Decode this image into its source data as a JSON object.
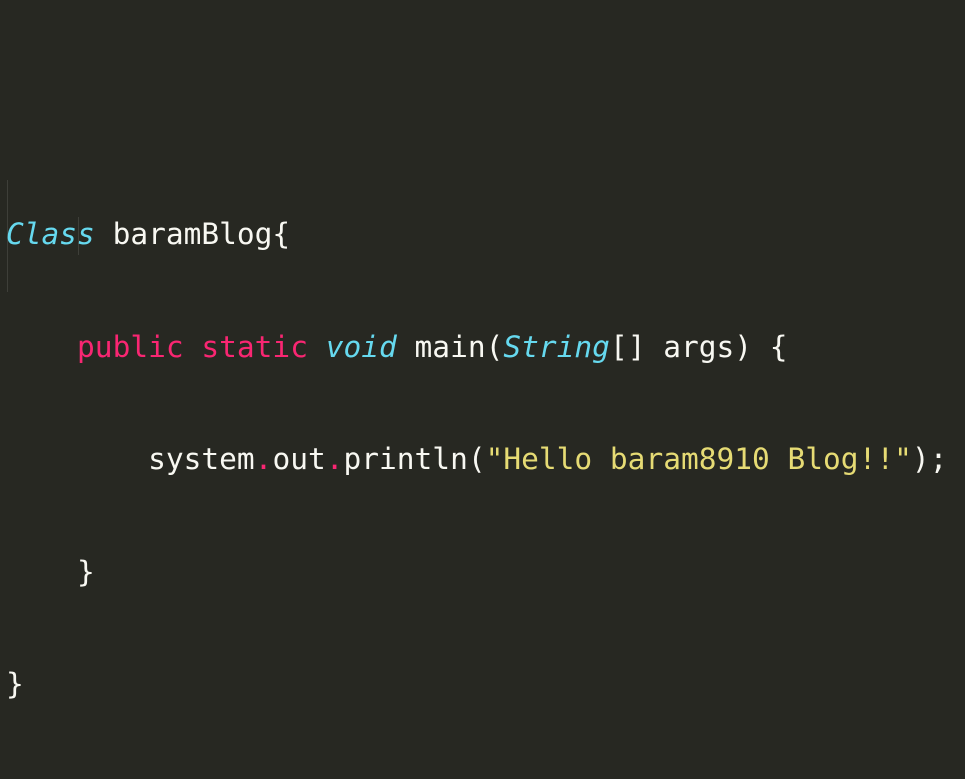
{
  "theme": {
    "background": "#272822",
    "foreground": "#F8F8F2",
    "keyword": "#F92672",
    "type": "#66D9EF",
    "string": "#E6DB74"
  },
  "code": {
    "line1": {
      "class_kw": "Class",
      "name": " baramBlog{"
    },
    "line2": {
      "indent": "    ",
      "public_kw": "public",
      "sp1": " ",
      "static_kw": "static",
      "sp2": " ",
      "void_kw": "void",
      "method": " main(",
      "string_type": "String",
      "rest": "[] args) {"
    },
    "line3": {
      "indent": "        ",
      "system": "system",
      "dot1": ".",
      "out": "out",
      "dot2": ".",
      "println": "println(",
      "literal": "\"Hello baram8910 Blog!!\"",
      "end": ");"
    },
    "line4": {
      "indent": "    ",
      "brace": "}"
    },
    "line5": {
      "brace": "}"
    }
  }
}
